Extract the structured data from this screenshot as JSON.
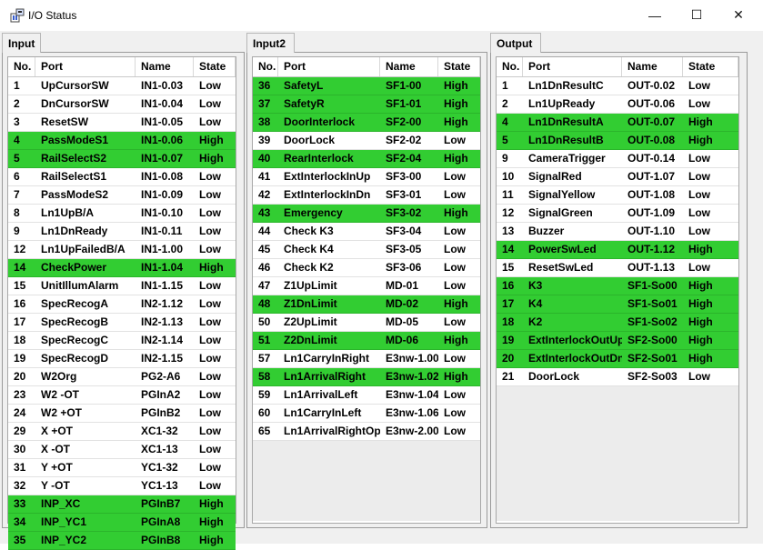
{
  "window": {
    "title": "I/O Status",
    "icon": "io-status-app-icon",
    "minimize_glyph": "—",
    "maximize_glyph": "☐",
    "close_glyph": "✕"
  },
  "colors": {
    "active_row": "#32cd32",
    "background": "#f0f0f0"
  },
  "columns": {
    "no": "No.",
    "port": "Port",
    "name": "Name",
    "state": "State"
  },
  "groups": [
    {
      "label": "Input",
      "rows": [
        {
          "no": "1",
          "port": "UpCursorSW",
          "name": "IN1-0.03",
          "state": "Low"
        },
        {
          "no": "2",
          "port": "DnCursorSW",
          "name": "IN1-0.04",
          "state": "Low"
        },
        {
          "no": "3",
          "port": "ResetSW",
          "name": "IN1-0.05",
          "state": "Low"
        },
        {
          "no": "4",
          "port": "PassModeS1",
          "name": "IN1-0.06",
          "state": "High"
        },
        {
          "no": "5",
          "port": "RailSelectS2",
          "name": "IN1-0.07",
          "state": "High"
        },
        {
          "no": "6",
          "port": "RailSelectS1",
          "name": "IN1-0.08",
          "state": "Low"
        },
        {
          "no": "7",
          "port": "PassModeS2",
          "name": "IN1-0.09",
          "state": "Low"
        },
        {
          "no": "8",
          "port": "Ln1UpB/A",
          "name": "IN1-0.10",
          "state": "Low"
        },
        {
          "no": "9",
          "port": "Ln1DnReady",
          "name": "IN1-0.11",
          "state": "Low"
        },
        {
          "no": "12",
          "port": "Ln1UpFailedB/A",
          "name": "IN1-1.00",
          "state": "Low"
        },
        {
          "no": "14",
          "port": "CheckPower",
          "name": "IN1-1.04",
          "state": "High"
        },
        {
          "no": "15",
          "port": "UnitIllumAlarm",
          "name": "IN1-1.15",
          "state": "Low"
        },
        {
          "no": "16",
          "port": "SpecRecogA",
          "name": "IN2-1.12",
          "state": "Low"
        },
        {
          "no": "17",
          "port": "SpecRecogB",
          "name": "IN2-1.13",
          "state": "Low"
        },
        {
          "no": "18",
          "port": "SpecRecogC",
          "name": "IN2-1.14",
          "state": "Low"
        },
        {
          "no": "19",
          "port": "SpecRecogD",
          "name": "IN2-1.15",
          "state": "Low"
        },
        {
          "no": "20",
          "port": "W2Org",
          "name": "PG2-A6",
          "state": "Low"
        },
        {
          "no": "23",
          "port": "W2 -OT",
          "name": "PGInA2",
          "state": "Low"
        },
        {
          "no": "24",
          "port": "W2 +OT",
          "name": "PGInB2",
          "state": "Low"
        },
        {
          "no": "29",
          "port": "X +OT",
          "name": "XC1-32",
          "state": "Low"
        },
        {
          "no": "30",
          "port": "X -OT",
          "name": "XC1-13",
          "state": "Low"
        },
        {
          "no": "31",
          "port": "Y +OT",
          "name": "YC1-32",
          "state": "Low"
        },
        {
          "no": "32",
          "port": "Y -OT",
          "name": "YC1-13",
          "state": "Low"
        },
        {
          "no": "33",
          "port": "INP_XC",
          "name": "PGInB7",
          "state": "High"
        },
        {
          "no": "34",
          "port": "INP_YC1",
          "name": "PGInA8",
          "state": "High"
        },
        {
          "no": "35",
          "port": "INP_YC2",
          "name": "PGInB8",
          "state": "High"
        }
      ]
    },
    {
      "label": "Input2",
      "rows": [
        {
          "no": "36",
          "port": "SafetyL",
          "name": "SF1-00",
          "state": "High"
        },
        {
          "no": "37",
          "port": "SafetyR",
          "name": "SF1-01",
          "state": "High"
        },
        {
          "no": "38",
          "port": "DoorInterlock",
          "name": "SF2-00",
          "state": "High"
        },
        {
          "no": "39",
          "port": "DoorLock",
          "name": "SF2-02",
          "state": "Low"
        },
        {
          "no": "40",
          "port": "RearInterlock",
          "name": "SF2-04",
          "state": "High"
        },
        {
          "no": "41",
          "port": "ExtInterlockInUp",
          "name": "SF3-00",
          "state": "Low"
        },
        {
          "no": "42",
          "port": "ExtInterlockInDn",
          "name": "SF3-01",
          "state": "Low"
        },
        {
          "no": "43",
          "port": "Emergency",
          "name": "SF3-02",
          "state": "High"
        },
        {
          "no": "44",
          "port": "Check K3",
          "name": "SF3-04",
          "state": "Low"
        },
        {
          "no": "45",
          "port": "Check K4",
          "name": "SF3-05",
          "state": "Low"
        },
        {
          "no": "46",
          "port": "Check K2",
          "name": "SF3-06",
          "state": "Low"
        },
        {
          "no": "47",
          "port": "Z1UpLimit",
          "name": "MD-01",
          "state": "Low"
        },
        {
          "no": "48",
          "port": "Z1DnLimit",
          "name": "MD-02",
          "state": "High"
        },
        {
          "no": "50",
          "port": "Z2UpLimit",
          "name": "MD-05",
          "state": "Low"
        },
        {
          "no": "51",
          "port": "Z2DnLimit",
          "name": "MD-06",
          "state": "High"
        },
        {
          "no": "57",
          "port": "Ln1CarryInRight",
          "name": "E3nw-1.00",
          "state": "Low"
        },
        {
          "no": "58",
          "port": "Ln1ArrivalRight",
          "name": "E3nw-1.02",
          "state": "High"
        },
        {
          "no": "59",
          "port": "Ln1ArrivalLeft",
          "name": "E3nw-1.04",
          "state": "Low"
        },
        {
          "no": "60",
          "port": "Ln1CarryInLeft",
          "name": "E3nw-1.06",
          "state": "Low"
        },
        {
          "no": "65",
          "port": "Ln1ArrivalRightOp",
          "name": "E3nw-2.00",
          "state": "Low"
        }
      ]
    },
    {
      "label": "Output",
      "rows": [
        {
          "no": "1",
          "port": "Ln1DnResultC",
          "name": "OUT-0.02",
          "state": "Low"
        },
        {
          "no": "2",
          "port": "Ln1UpReady",
          "name": "OUT-0.06",
          "state": "Low"
        },
        {
          "no": "4",
          "port": "Ln1DnResultA",
          "name": "OUT-0.07",
          "state": "High"
        },
        {
          "no": "5",
          "port": "Ln1DnResultB",
          "name": "OUT-0.08",
          "state": "High"
        },
        {
          "no": "9",
          "port": "CameraTrigger",
          "name": "OUT-0.14",
          "state": "Low"
        },
        {
          "no": "10",
          "port": "SignalRed",
          "name": "OUT-1.07",
          "state": "Low"
        },
        {
          "no": "11",
          "port": "SignalYellow",
          "name": "OUT-1.08",
          "state": "Low"
        },
        {
          "no": "12",
          "port": "SignalGreen",
          "name": "OUT-1.09",
          "state": "Low"
        },
        {
          "no": "13",
          "port": "Buzzer",
          "name": "OUT-1.10",
          "state": "Low"
        },
        {
          "no": "14",
          "port": "PowerSwLed",
          "name": "OUT-1.12",
          "state": "High"
        },
        {
          "no": "15",
          "port": "ResetSwLed",
          "name": "OUT-1.13",
          "state": "Low"
        },
        {
          "no": "16",
          "port": "K3",
          "name": "SF1-So00",
          "state": "High"
        },
        {
          "no": "17",
          "port": "K4",
          "name": "SF1-So01",
          "state": "High"
        },
        {
          "no": "18",
          "port": "K2",
          "name": "SF1-So02",
          "state": "High"
        },
        {
          "no": "19",
          "port": "ExtInterlockOutUp",
          "name": "SF2-So00",
          "state": "High"
        },
        {
          "no": "20",
          "port": "ExtInterlockOutDn",
          "name": "SF2-So01",
          "state": "High"
        },
        {
          "no": "21",
          "port": "DoorLock",
          "name": "SF2-So03",
          "state": "Low"
        }
      ]
    }
  ]
}
